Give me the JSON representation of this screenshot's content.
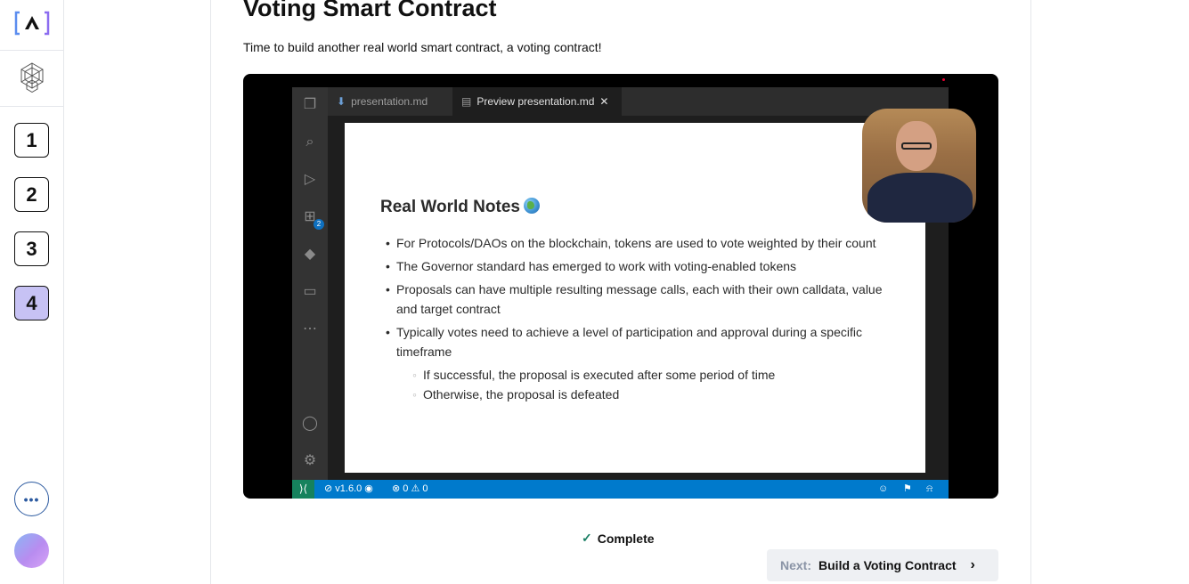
{
  "sidebar": {
    "logo_icon": "alchemy-bracket-logo-icon",
    "secondary_logo_icon": "hexagon-logo-icon",
    "steps": [
      {
        "label": "1",
        "active": false
      },
      {
        "label": "2",
        "active": false
      },
      {
        "label": "3",
        "active": false
      },
      {
        "label": "4",
        "active": true
      }
    ],
    "more_icon": "ellipsis-icon",
    "avatar_colors": [
      "#8ab6f4",
      "#b88cf0",
      "#d7a4f6"
    ]
  },
  "main": {
    "title": "Voting Smart Contract",
    "subtitle": "Time to build another real world smart contract, a voting contract!"
  },
  "video": {
    "editor_tabs": [
      {
        "label": "presentation.md"
      },
      {
        "label": "Preview presentation.md"
      }
    ],
    "slide_title": "Real World Notes",
    "bullets": [
      "For Protocols/DAOs on the blockchain, tokens are used to vote weighted by their count",
      "The Governor standard has emerged to work with voting-enabled tokens",
      "Proposals can have multiple resulting message calls, each with their own calldata, value and target contract",
      "Typically votes need to achieve a level of participation and approval during a specific timeframe"
    ],
    "sub_bullets": [
      "If successful, the proposal is executed after some period of time",
      "Otherwise, the proposal is defeated"
    ],
    "status_version": "v1.6.0",
    "status_errors": "0",
    "status_warnings": "0",
    "extensions_badge": "2"
  },
  "actions": {
    "complete_label": "Complete",
    "next_prefix": "Next:",
    "next_label": "Build a Voting Contract"
  },
  "colors": {
    "accent_step": "#c7c2f4",
    "complete_check": "#1a7f64",
    "statusbar": "#007acc"
  }
}
